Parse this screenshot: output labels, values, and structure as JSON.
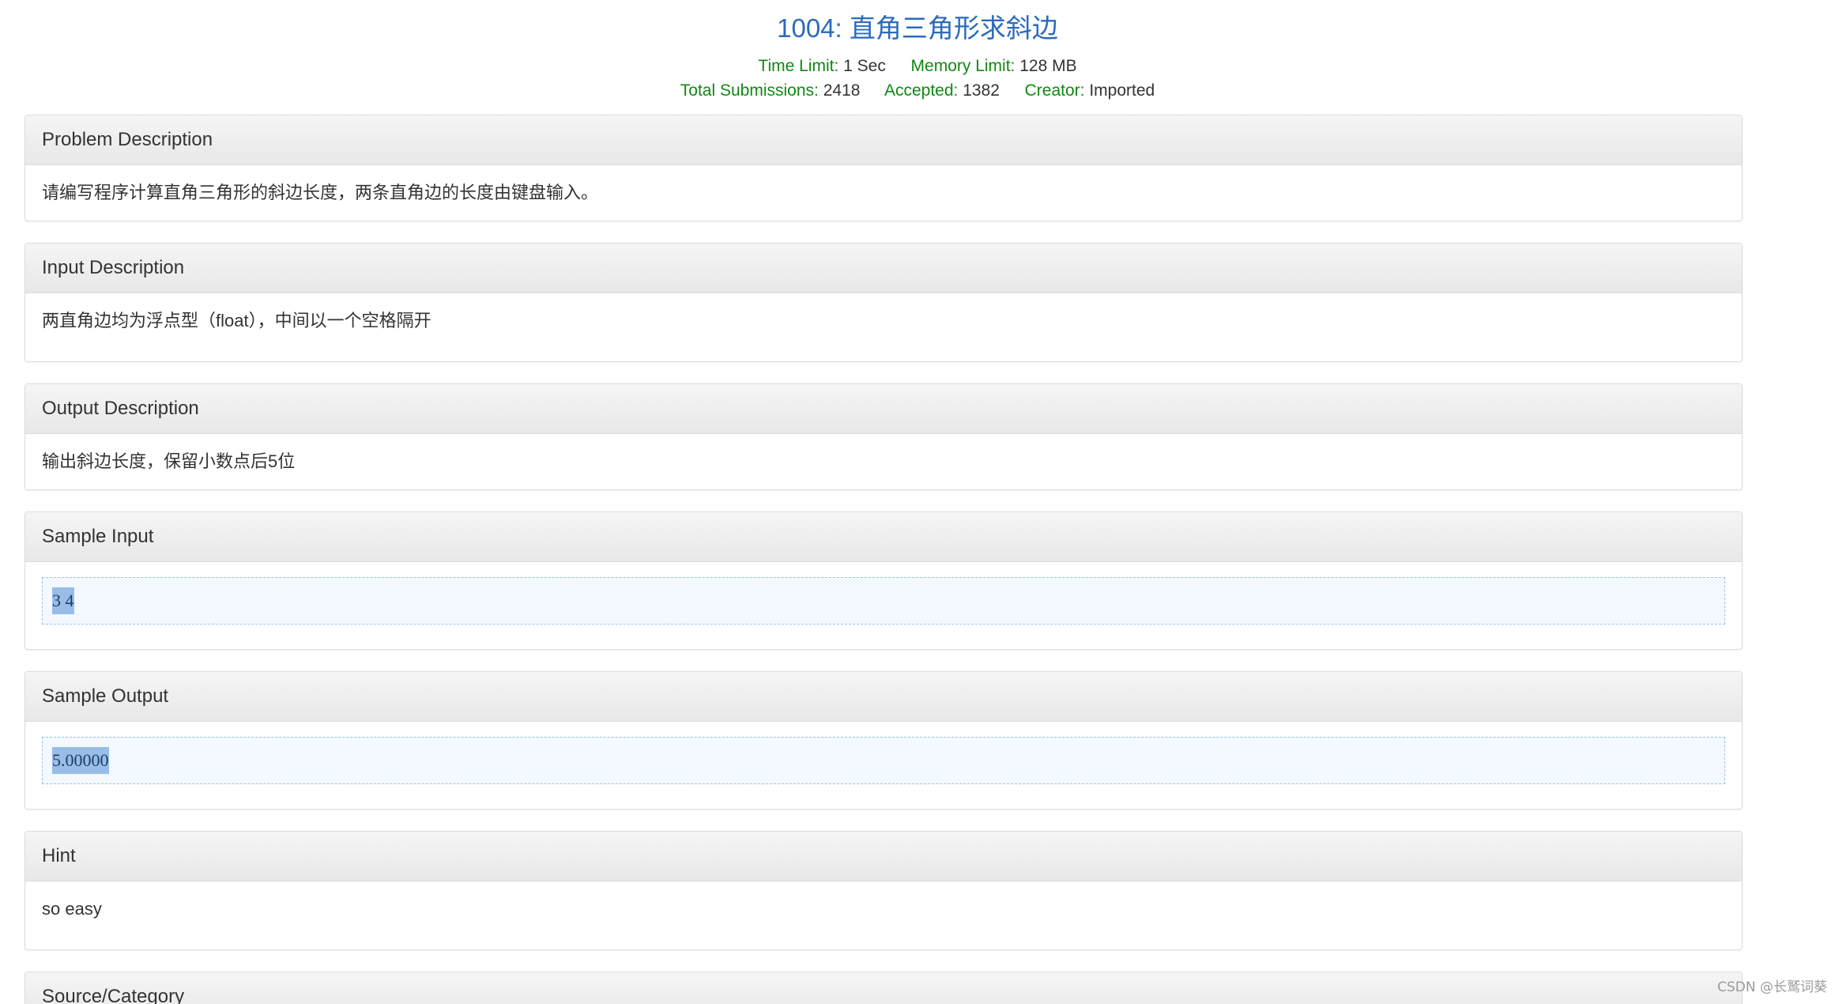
{
  "problem": {
    "title": "1004: 直角三角形求斜边",
    "meta": {
      "time_limit_label": "Time Limit:",
      "time_limit_value": "1 Sec",
      "memory_limit_label": "Memory Limit:",
      "memory_limit_value": "128 MB",
      "total_submissions_label": "Total Submissions:",
      "total_submissions_value": "2418",
      "accepted_label": "Accepted:",
      "accepted_value": "1382",
      "creator_label": "Creator:",
      "creator_value": "Imported"
    }
  },
  "sections": {
    "description": {
      "heading": "Problem Description",
      "text": "请编写程序计算直角三角形的斜边长度，两条直角边的长度由键盘输入。"
    },
    "input": {
      "heading": "Input Description",
      "text": "两直角边均为浮点型（float），中间以一个空格隔开"
    },
    "output": {
      "heading": "Output Description",
      "text": "输出斜边长度，保留小数点后5位"
    },
    "sample_input": {
      "heading": "Sample Input",
      "text": "3 4"
    },
    "sample_output": {
      "heading": "Sample Output",
      "text": "5.00000"
    },
    "hint": {
      "heading": "Hint",
      "text": "so easy"
    },
    "source": {
      "heading": "Source/Category"
    }
  },
  "watermark": "CSDN @长鹫词葵",
  "colors": {
    "title": "#2a6bbf",
    "meta_label": "#118811",
    "sample_bg": "#f3f9fe",
    "selection": "#98bde8"
  }
}
